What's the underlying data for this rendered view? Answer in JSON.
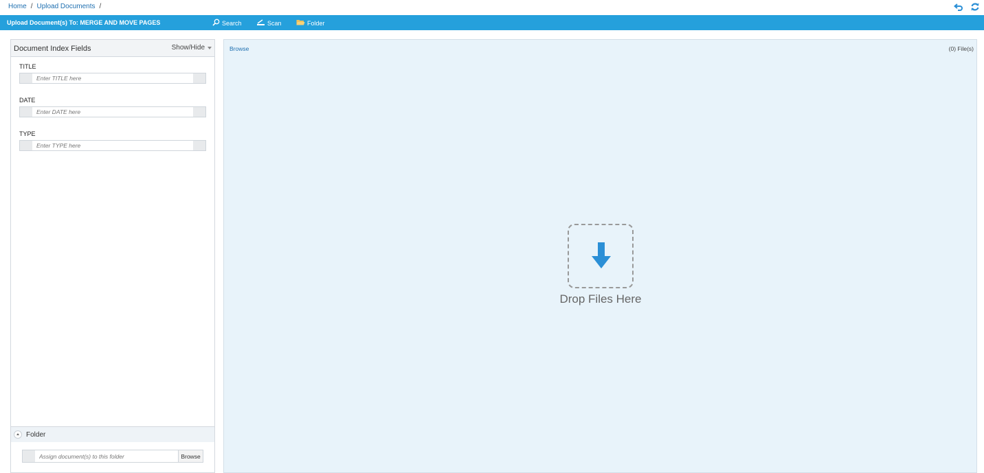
{
  "breadcrumb": {
    "items": [
      "Home",
      "Upload Documents"
    ],
    "separator": "/"
  },
  "top_icons": [
    "back-arrow-icon",
    "refresh-icon"
  ],
  "toolbar": {
    "title": "Upload Document(s) To:  MERGE AND MOVE PAGES",
    "search_label": "Search",
    "scan_label": "Scan",
    "folder_label": "Folder",
    "bg_color": "#25a0dc"
  },
  "index_panel": {
    "title": "Document Index Fields",
    "show_hide_label": "Show/Hide",
    "fields": [
      {
        "label": "TITLE",
        "placeholder": "Enter TITLE here"
      },
      {
        "label": "DATE",
        "placeholder": "Enter DATE here"
      },
      {
        "label": "TYPE",
        "placeholder": "Enter TYPE here"
      }
    ]
  },
  "folder_section": {
    "label": "Folder",
    "placeholder": "Assign document(s) to this folder",
    "browse_label": "Browse"
  },
  "dropzone": {
    "browse_label": "Browse",
    "file_count": "(0) File(s)",
    "drop_text": "Drop Files Here",
    "arrow_color": "#2b8fd6"
  }
}
